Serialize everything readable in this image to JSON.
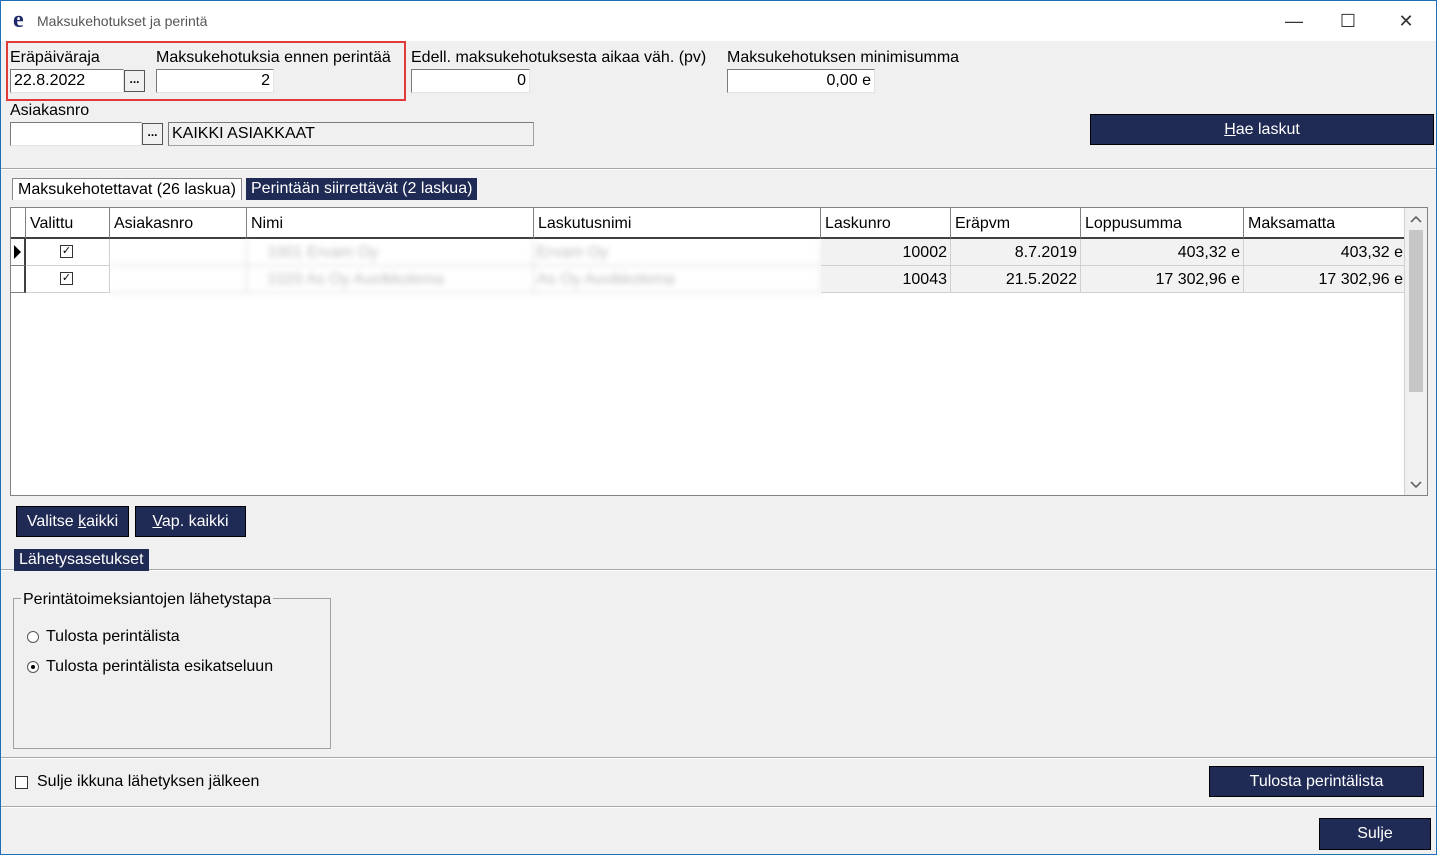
{
  "window": {
    "title": "Maksukehotukset ja perintä",
    "app_icon_letter": "e",
    "controls": {
      "minimize": "—",
      "maximize": "☐",
      "close": "✕"
    }
  },
  "filters": {
    "erapaivaraja_label": "Eräpäiväraja",
    "erapaivaraja_value": "22.8.2022",
    "maksukehotuksia_label": "Maksukehotuksia ennen perintää",
    "maksukehotuksia_value": "2",
    "edell_label": "Edell. maksukehotuksesta aikaa väh. (pv)",
    "edell_value": "0",
    "minimisumma_label": "Maksukehotuksen minimisumma",
    "minimisumma_value": "0,00 e",
    "asiakasnro_label": "Asiakasnro",
    "asiakasnro_value": "",
    "asiakas_name": "KAIKKI ASIAKKAAT",
    "ellipsis": "...",
    "hae_button_first": "H",
    "hae_button_rest": "ae laskut"
  },
  "tabs": [
    {
      "label": "Maksukehotettavat (26 laskua)"
    },
    {
      "label": "Perintään siirrettävät (2 laskua)"
    }
  ],
  "table": {
    "columns": [
      "Valittu",
      "Asiakasnro",
      "Nimi",
      "Laskutusnimi",
      "Laskunro",
      "Eräpvm",
      "Loppusumma",
      "Maksamatta"
    ],
    "rows": [
      {
        "valittu": true,
        "asiakasnro": "",
        "nimi": "1001 Ervam Oy",
        "laskutusnimi": "Ervam Oy",
        "laskunro": "10002",
        "erapvm": "8.7.2019",
        "loppusumma": "403,32 e",
        "maksamatta": "403,32 e"
      },
      {
        "valittu": true,
        "asiakasnro": "",
        "nimi": "1020 As Oy Auvikkolema",
        "laskutusnimi": "As Oy Auvikkolema",
        "laskunro": "10043",
        "erapvm": "21.5.2022",
        "loppusumma": "17 302,96 e",
        "maksamatta": "17 302,96 e"
      }
    ]
  },
  "buttons": {
    "valitse_pre": "Valitse ",
    "valitse_u": "k",
    "valitse_post": "aikki",
    "vap_u": "V",
    "vap_post": "ap. kaikki",
    "tulosta": "Tulosta perintälista",
    "sulje": "Sulje"
  },
  "settings": {
    "tab_label": "Lähetysasetukset",
    "group_label": "Perintätoimeksiantojen lähetystapa",
    "options": [
      {
        "label": "Tulosta perintälista",
        "selected": false
      },
      {
        "label": "Tulosta perintälista esikatseluun",
        "selected": true
      }
    ],
    "close_after_label": "Sulje ikkuna lähetyksen jälkeen",
    "close_after_checked": false
  },
  "colors": {
    "button_bg": "#1f2a55",
    "highlight": "#e03a3a",
    "window_bg": "#f0f0f0"
  }
}
